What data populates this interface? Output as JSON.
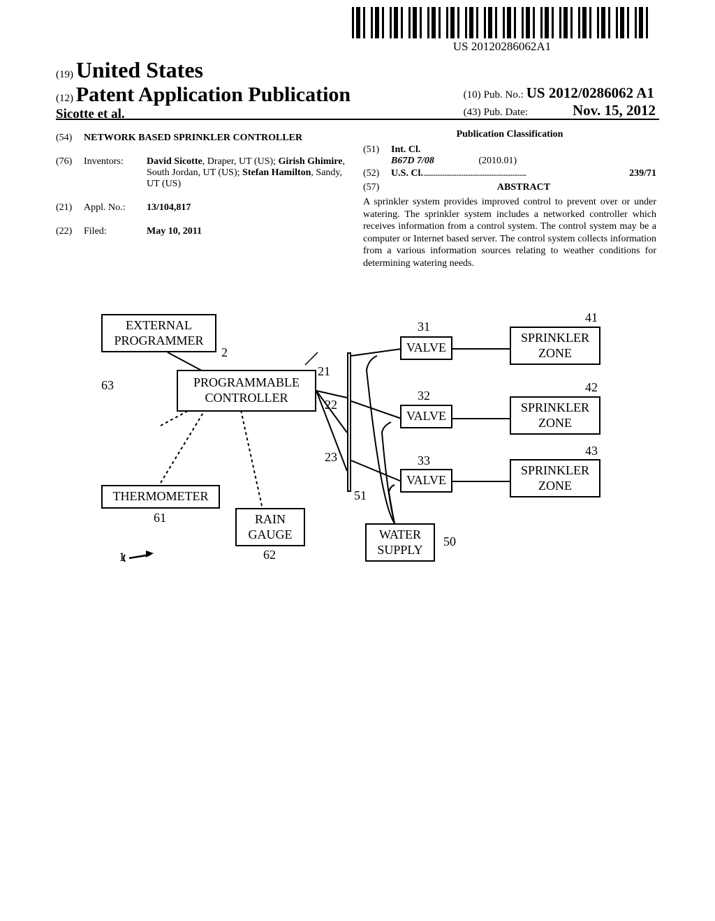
{
  "barcode_text": "US 20120286062A1",
  "country_code": "(19)",
  "country_name": "United States",
  "pub_type_code": "(12)",
  "pub_type": "Patent Application Publication",
  "authors": "Sicotte et al.",
  "pub_num_code": "(10)",
  "pub_num_label": "Pub. No.:",
  "pub_num": "US 2012/0286062 A1",
  "pub_date_code": "(43)",
  "pub_date_label": "Pub. Date:",
  "pub_date": "Nov. 15, 2012",
  "title": {
    "code": "(54)",
    "text": "NETWORK BASED SPRINKLER CONTROLLER"
  },
  "inventors": {
    "code": "(76)",
    "label": "Inventors:",
    "list": [
      {
        "name": "David Sicotte",
        "loc": ", Draper, UT (US); "
      },
      {
        "name": "Girish Ghimire",
        "loc": ", South Jordan, UT (US); "
      },
      {
        "name": "Stefan Hamilton",
        "loc": ", Sandy, UT (US)"
      }
    ]
  },
  "appl_no": {
    "code": "(21)",
    "label": "Appl. No.:",
    "value": "13/104,817"
  },
  "filed": {
    "code": "(22)",
    "label": "Filed:",
    "value": "May 10, 2011"
  },
  "classification_heading": "Publication Classification",
  "int_cl": {
    "code": "(51)",
    "label": "Int. Cl.",
    "class": "B67D 7/08",
    "version": "(2010.01)"
  },
  "us_cl": {
    "code": "(52)",
    "label": "U.S. Cl.",
    "dots": " ........................................................... ",
    "value": "239/71"
  },
  "abstract": {
    "code": "(57)",
    "heading": "ABSTRACT",
    "text": "A sprinkler system provides improved control to prevent over or under watering. The sprinkler system includes a networked controller which receives information from a control system. The control system may be a computer or Internet based server. The control system collects information from a various information sources relating to weather conditions for determining watering needs."
  },
  "diagram": {
    "external_programmer": "EXTERNAL\nPROGRAMMER",
    "programmable_controller": "PROGRAMMABLE\nCONTROLLER",
    "thermometer": "THERMOMETER",
    "rain_gauge": "RAIN\nGAUGE",
    "water_supply": "WATER\nSUPPLY",
    "valve": "VALVE",
    "sprinkler_zone": "SPRINKLER\nZONE",
    "labels": {
      "n2": "2",
      "n63": "63",
      "n21": "21",
      "n22": "22",
      "n23": "23",
      "n31": "31",
      "n32": "32",
      "n33": "33",
      "n41": "41",
      "n42": "42",
      "n43": "43",
      "n50": "50",
      "n51": "51",
      "n61": "61",
      "n62": "62",
      "n1": "1"
    }
  }
}
